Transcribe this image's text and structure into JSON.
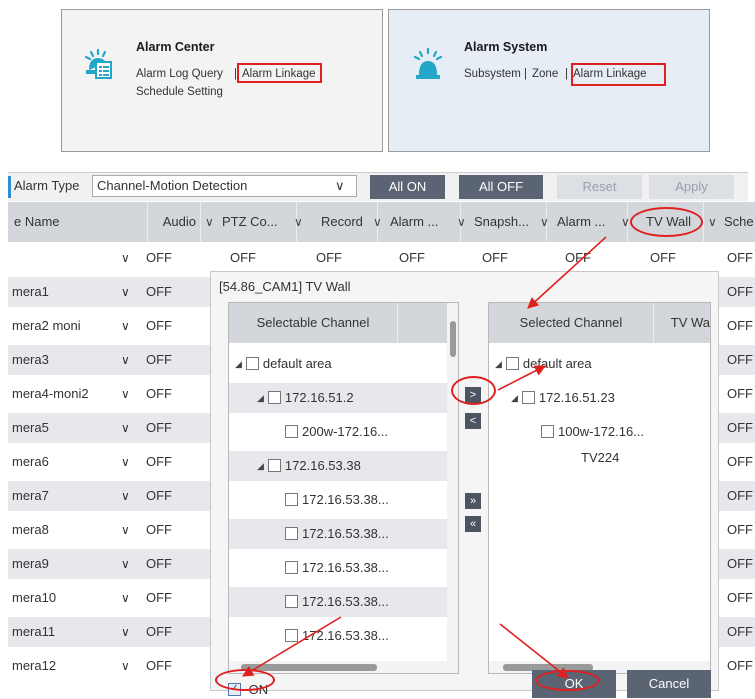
{
  "cards": {
    "alarm_center": {
      "title": "Alarm Center",
      "link_log": "Alarm Log Query",
      "sep": "|",
      "link_linkage": "Alarm Linkage",
      "link_schedule": "Schedule Setting"
    },
    "alarm_system": {
      "title": "Alarm System",
      "link_subsystem": "Subsystem",
      "sep1": "|",
      "link_zone": "Zone",
      "sep2": "|",
      "link_linkage": "Alarm Linkage"
    }
  },
  "toolbar": {
    "alarm_type_label": "Alarm Type",
    "alarm_type_value": "Channel-Motion Detection",
    "all_on": "All ON",
    "all_off": "All OFF",
    "reset": "Reset",
    "apply": "Apply"
  },
  "grid": {
    "headers": [
      "e Name",
      "Audio",
      "PTZ Co...",
      "Record",
      "Alarm ...",
      "Snapsh...",
      "Alarm ...",
      "TV Wall",
      "Sche"
    ],
    "off": "OFF",
    "rows": [
      "",
      "mera1",
      "mera2 moni",
      "mera3",
      "mera4-moni2",
      "mera5",
      "mera6",
      "mera7",
      "mera8",
      "mera9",
      "mera10",
      "mera11",
      "mera12"
    ]
  },
  "dialog": {
    "title": "[54.86_CAM1] TV Wall",
    "left_header": "Selectable Channel",
    "left_tree": [
      "default area",
      "172.16.51.2",
      "200w-172.16...",
      "172.16.53.38",
      "172.16.53.38...",
      "172.16.53.38...",
      "172.16.53.38...",
      "172.16.53.38...",
      "172.16.53.38..."
    ],
    "right_header": "Selected Channel",
    "right_header2": "TV Wa",
    "right_tree": [
      "default area",
      "172.16.51.23",
      "100w-172.16..."
    ],
    "right_tv": "TV224",
    "btn_add": ">",
    "btn_remove": "<",
    "btn_add_all": "»",
    "btn_remove_all": "«",
    "on_label": "ON",
    "ok": "OK",
    "cancel": "Cancel"
  },
  "colors": {
    "annotation": "#e02020",
    "header_bg": "#d3d7dc",
    "button_dark": "#5b6472",
    "row_alt": "#e6e8eb"
  }
}
